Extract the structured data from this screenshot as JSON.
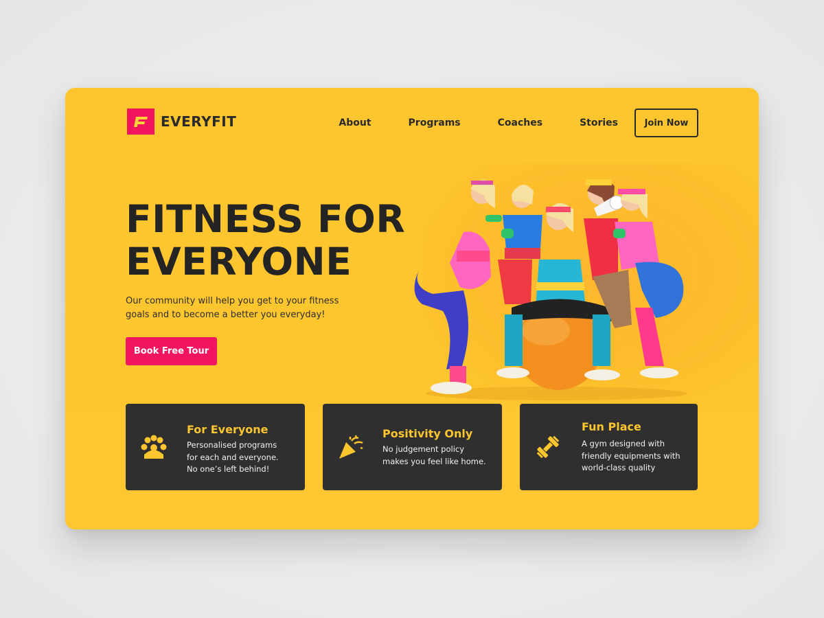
{
  "brand": {
    "name": "EVERYFIT",
    "logo_letter": "F",
    "color": "#f2155d"
  },
  "nav": {
    "links": [
      "About",
      "Programs",
      "Coaches",
      "Stories"
    ],
    "cta": "Join Now"
  },
  "hero": {
    "title_line1": "FITNESS FOR",
    "title_line2": "EVERYONE",
    "subtitle": "Our community will help you get to your fitness goals and to become a better you everyday!",
    "cta": "Book Free Tour",
    "image_alt_icon": "group-photo"
  },
  "features": [
    {
      "icon": "community-icon",
      "title": "For Everyone",
      "desc_lines": [
        "Personalised programs",
        "for each and everyone.",
        "No one’s left behind!"
      ]
    },
    {
      "icon": "party-popper-icon",
      "title": "Positivity Only",
      "desc_lines": [
        "No judgement policy",
        "makes you feel like home."
      ]
    },
    {
      "icon": "dumbbell-icon",
      "title": "Fun Place",
      "desc_lines": [
        "A gym designed with",
        "friendly equipments with",
        "world-class quality"
      ]
    }
  ],
  "colors": {
    "background": "#fdc52e",
    "accent": "#f2155d",
    "dark": "#2f2f2f",
    "feature_title": "#fdc52e"
  }
}
